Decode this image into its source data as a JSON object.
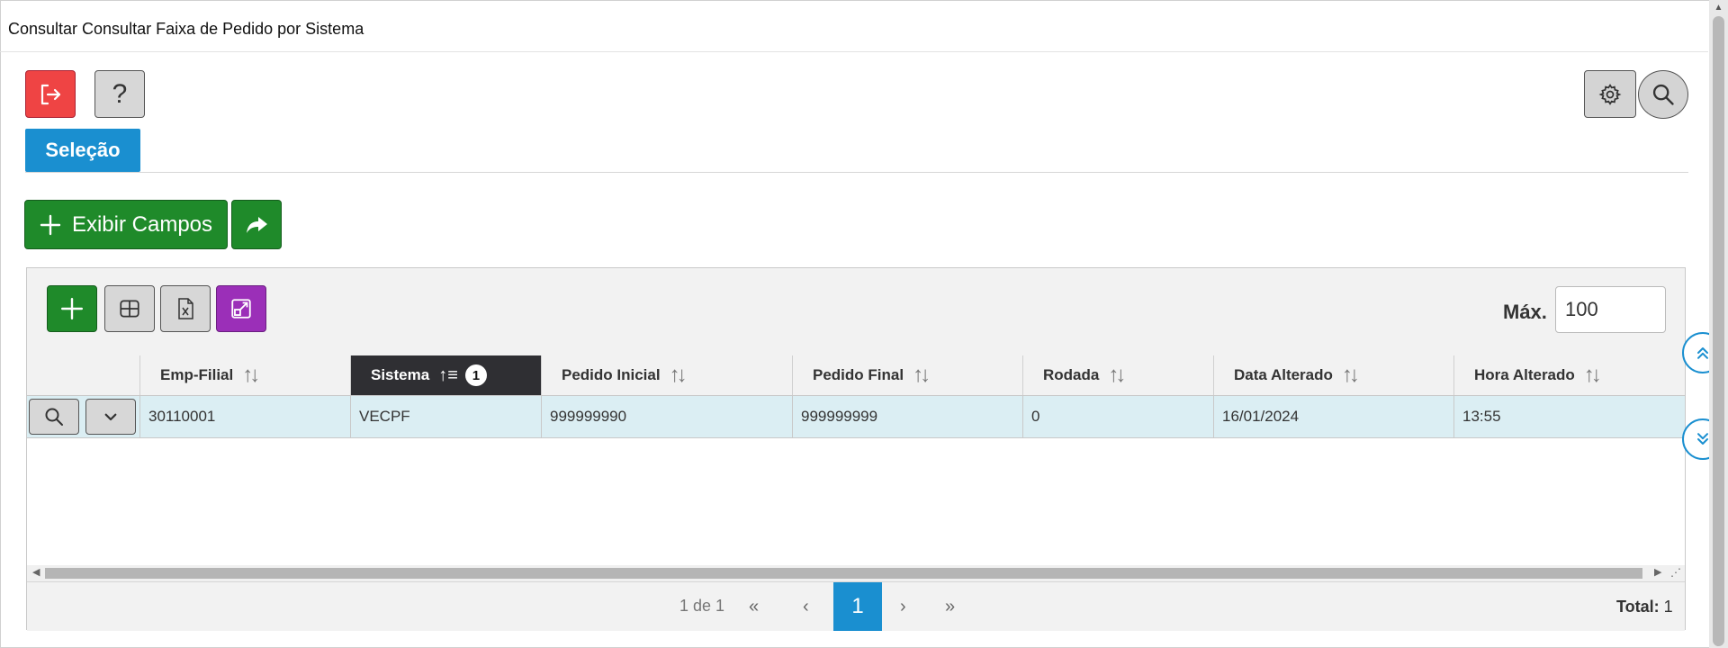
{
  "window": {
    "title": "Consultar Consultar Faixa de Pedido por Sistema"
  },
  "toolbar": {
    "exit_icon": "exit-icon",
    "help_label": "?",
    "settings_icon": "gear-icon",
    "search_icon": "search-icon"
  },
  "tabs": [
    {
      "label": "Seleção"
    }
  ],
  "actions": {
    "exibir_campos_label": "Exibir Campos",
    "share_icon": "share-arrow-icon"
  },
  "grid_toolbar": {
    "add_icon": "plus-icon",
    "layout_icon": "grid-icon",
    "excel_icon": "excel-icon",
    "expand_icon": "expand-icon",
    "max_label": "Máx.",
    "max_value": "100"
  },
  "table": {
    "columns": [
      {
        "label": "Emp-Filial"
      },
      {
        "label": "Sistema",
        "sorted": "asc",
        "sort_order": "1"
      },
      {
        "label": "Pedido Inicial"
      },
      {
        "label": "Pedido Final"
      },
      {
        "label": "Rodada"
      },
      {
        "label": "Data Alterado"
      },
      {
        "label": "Hora Alterado"
      }
    ],
    "rows": [
      [
        "30110001",
        "VECPF",
        "999999990",
        "999999999",
        "0",
        "16/01/2024",
        "13:55"
      ]
    ]
  },
  "pagination": {
    "info": "1 de 1",
    "current_page": "1",
    "total_label": "Total:",
    "total_value": "1"
  },
  "colors": {
    "primary": "#1a8fd0",
    "success": "#1f8a2a",
    "danger": "#ef4444",
    "purple": "#9b2fb8",
    "row_selected": "#dbeef3"
  }
}
